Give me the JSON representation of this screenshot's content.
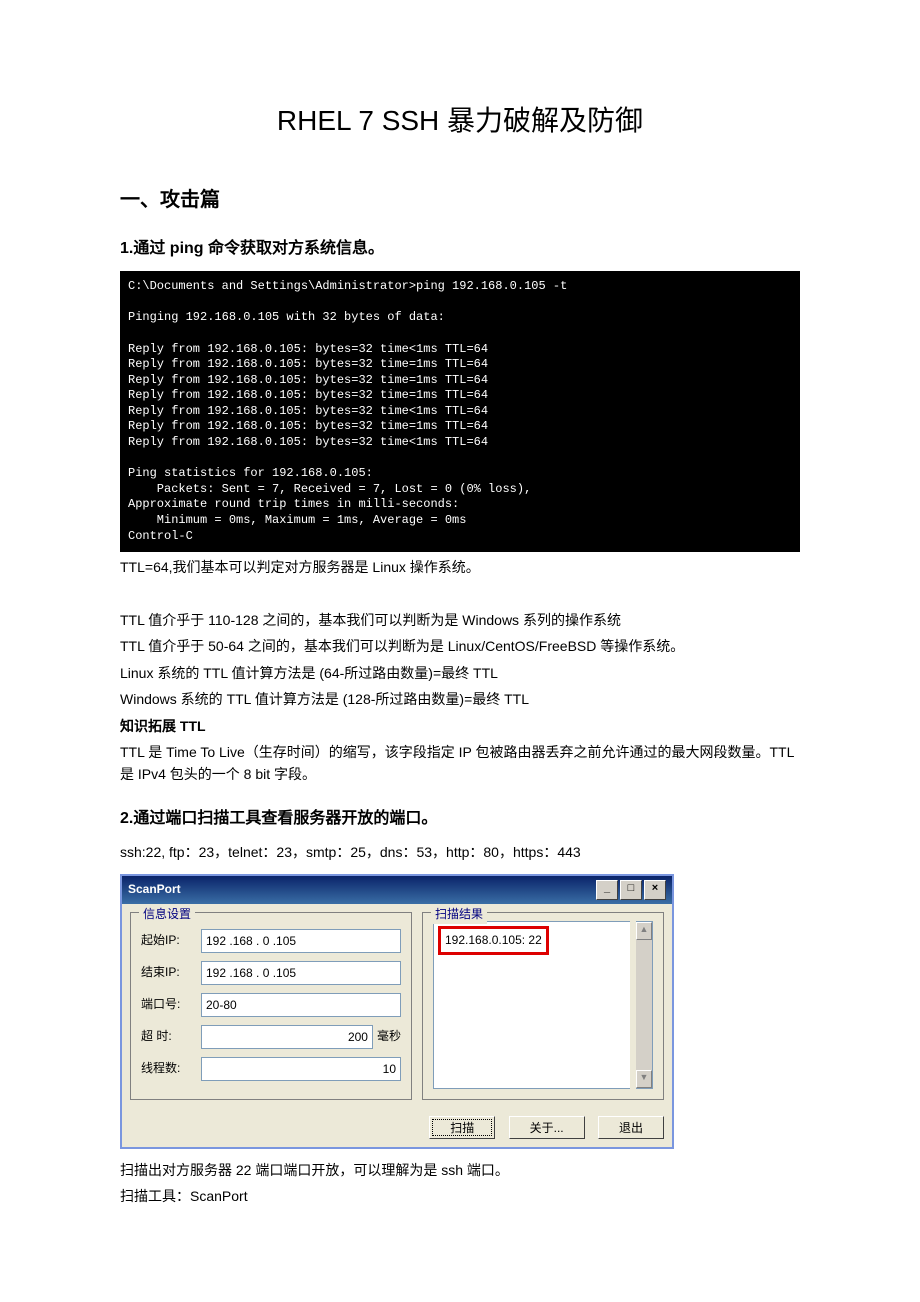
{
  "title": "RHEL 7 SSH 暴力破解及防御",
  "section1_heading": "一、攻击篇",
  "step1_heading": "1.通过 ping 命令获取对方系统信息。",
  "terminal_output": "C:\\Documents and Settings\\Administrator>ping 192.168.0.105 -t\n\nPinging 192.168.0.105 with 32 bytes of data:\n\nReply from 192.168.0.105: bytes=32 time<1ms TTL=64\nReply from 192.168.0.105: bytes=32 time=1ms TTL=64\nReply from 192.168.0.105: bytes=32 time=1ms TTL=64\nReply from 192.168.0.105: bytes=32 time=1ms TTL=64\nReply from 192.168.0.105: bytes=32 time<1ms TTL=64\nReply from 192.168.0.105: bytes=32 time=1ms TTL=64\nReply from 192.168.0.105: bytes=32 time<1ms TTL=64\n\nPing statistics for 192.168.0.105:\n    Packets: Sent = 7, Received = 7, Lost = 0 (0% loss),\nApproximate round trip times in milli-seconds:\n    Minimum = 0ms, Maximum = 1ms, Average = 0ms\nControl-C",
  "ttl_note": "TTL=64,我们基本可以判定对方服务器是 Linux 操作系统。",
  "ttl_para1": "TTL 值介乎于 110-128 之间的，基本我们可以判断为是 Windows 系列的操作系统",
  "ttl_para2": "TTL 值介乎于 50-64 之间的，基本我们可以判断为是 Linux/CentOS/FreeBSD 等操作系统。",
  "ttl_para3": "Linux 系统的 TTL 值计算方法是 (64-所过路由数量)=最终 TTL",
  "ttl_para4": "Windows 系统的 TTL 值计算方法是 (128-所过路由数量)=最终 TTL",
  "ttl_knowledge_heading": "知识拓展 TTL",
  "ttl_knowledge_para": "TTL 是 Time To Live（生存时间）的缩写，该字段指定 IP 包被路由器丢弃之前允许通过的最大网段数量。TTL 是 IPv4 包头的一个 8 bit 字段。",
  "step2_heading": "2.通过端口扫描工具查看服务器开放的端口。",
  "ports_line": "ssh:22, ftp：23，telnet：23，smtp：25，dns：53，http：80，https：443",
  "scanport": {
    "title": "ScanPort",
    "info_label": "信息设置",
    "start_ip_label": "起始IP:",
    "start_ip": "192 .168 . 0  .105",
    "end_ip_label": "结束IP:",
    "end_ip": "192 .168 . 0  .105",
    "port_label": "端口号:",
    "port": "20-80",
    "timeout_label": "超  时:",
    "timeout": "200",
    "timeout_unit": "毫秒",
    "threads_label": "线程数:",
    "threads": "10",
    "result_label": "扫描结果",
    "result": "192.168.0.105: 22",
    "btn_scan": "扫描",
    "btn_about": "关于...",
    "btn_exit": "退出",
    "min_btn": "_",
    "max_btn": "□",
    "close_btn": "×",
    "scroll_up": "▲",
    "scroll_down": "▼"
  },
  "scan_note1": "扫描出对方服务器 22 端口端口开放，可以理解为是 ssh 端口。",
  "scan_note2": "扫描工具：ScanPort"
}
